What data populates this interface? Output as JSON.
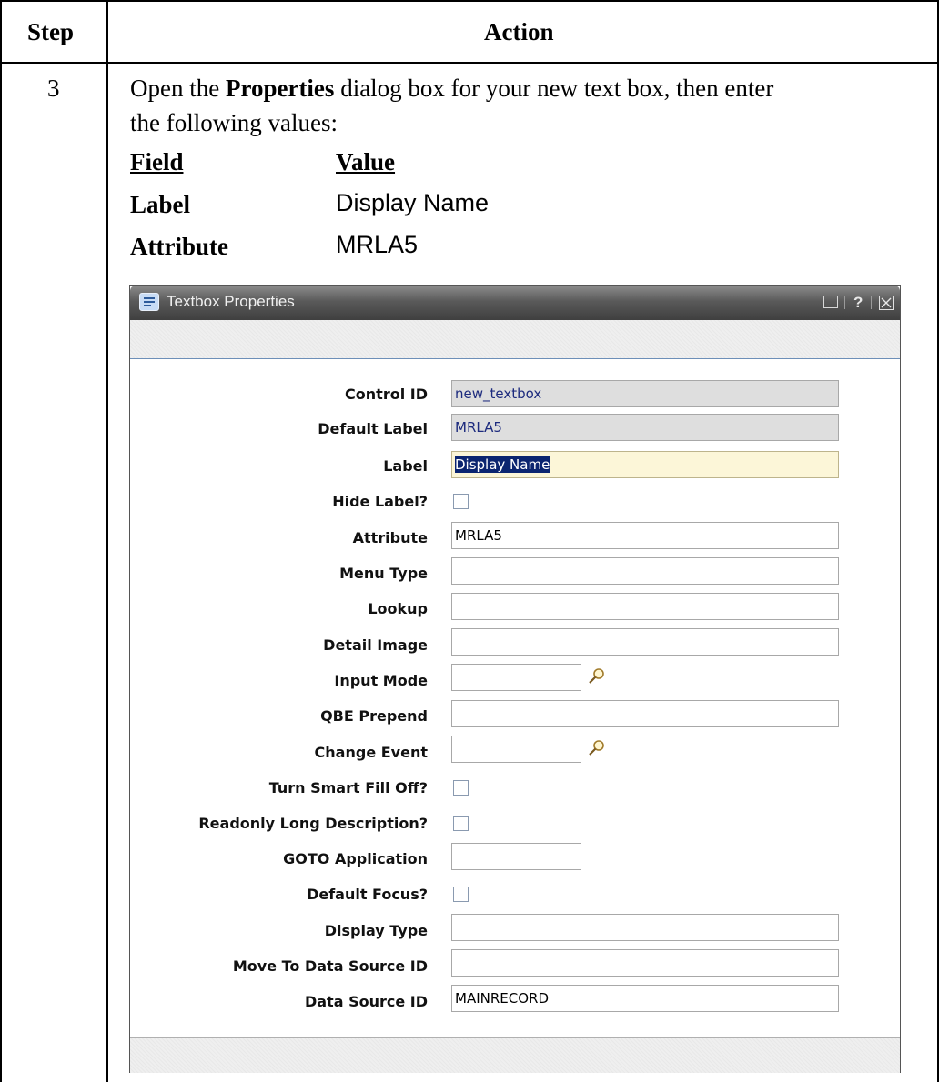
{
  "table": {
    "col_step": "Step",
    "col_action": "Action",
    "step_number": "3",
    "instruction_pre": "Open the ",
    "instruction_bold": "Properties",
    "instruction_post": " dialog box for your new text box, then enter",
    "instruction_line2": "the following values:",
    "fv_header_field": "Field",
    "fv_header_value": "Value",
    "fv_rows": [
      {
        "field": "Label",
        "value": "Display Name"
      },
      {
        "field": "Attribute",
        "value": "MRLA5"
      }
    ]
  },
  "dialog": {
    "title": "Textbox Properties",
    "title_icon": "speech-bubble-icon",
    "controls": {
      "menu_icon": "window-menu-icon",
      "help": "?",
      "close_icon": "close-box-icon"
    },
    "fields": [
      {
        "label": "Control ID",
        "type": "text",
        "value": "new_textbox",
        "state": "readonly"
      },
      {
        "label": "Default Label",
        "type": "text",
        "value": "MRLA5",
        "state": "readonly"
      },
      {
        "label": "Label",
        "type": "text",
        "value": "Display Name",
        "state": "focused-selected"
      },
      {
        "label": "Hide Label?",
        "type": "checkbox",
        "checked": false
      },
      {
        "label": "Attribute",
        "type": "text",
        "value": "MRLA5"
      },
      {
        "label": "Menu Type",
        "type": "text",
        "value": ""
      },
      {
        "label": "Lookup",
        "type": "text",
        "value": ""
      },
      {
        "label": "Detail Image",
        "type": "text",
        "value": ""
      },
      {
        "label": "Input Mode",
        "type": "text-lookup",
        "value": "",
        "icon": "magnifier-icon"
      },
      {
        "label": "QBE Prepend",
        "type": "text",
        "value": ""
      },
      {
        "label": "Change Event",
        "type": "text-lookup",
        "value": "",
        "icon": "magnifier-icon"
      },
      {
        "label": "Turn Smart Fill Off?",
        "type": "checkbox",
        "checked": false
      },
      {
        "label": "Readonly Long Description?",
        "type": "checkbox",
        "checked": false
      },
      {
        "label": "GOTO Application",
        "type": "text-short",
        "value": ""
      },
      {
        "label": "Default Focus?",
        "type": "checkbox",
        "checked": false
      },
      {
        "label": "Display Type",
        "type": "text",
        "value": ""
      },
      {
        "label": "Move To Data Source ID",
        "type": "text",
        "value": ""
      },
      {
        "label": "Data Source ID",
        "type": "text",
        "value": "MAINRECORD"
      }
    ]
  }
}
